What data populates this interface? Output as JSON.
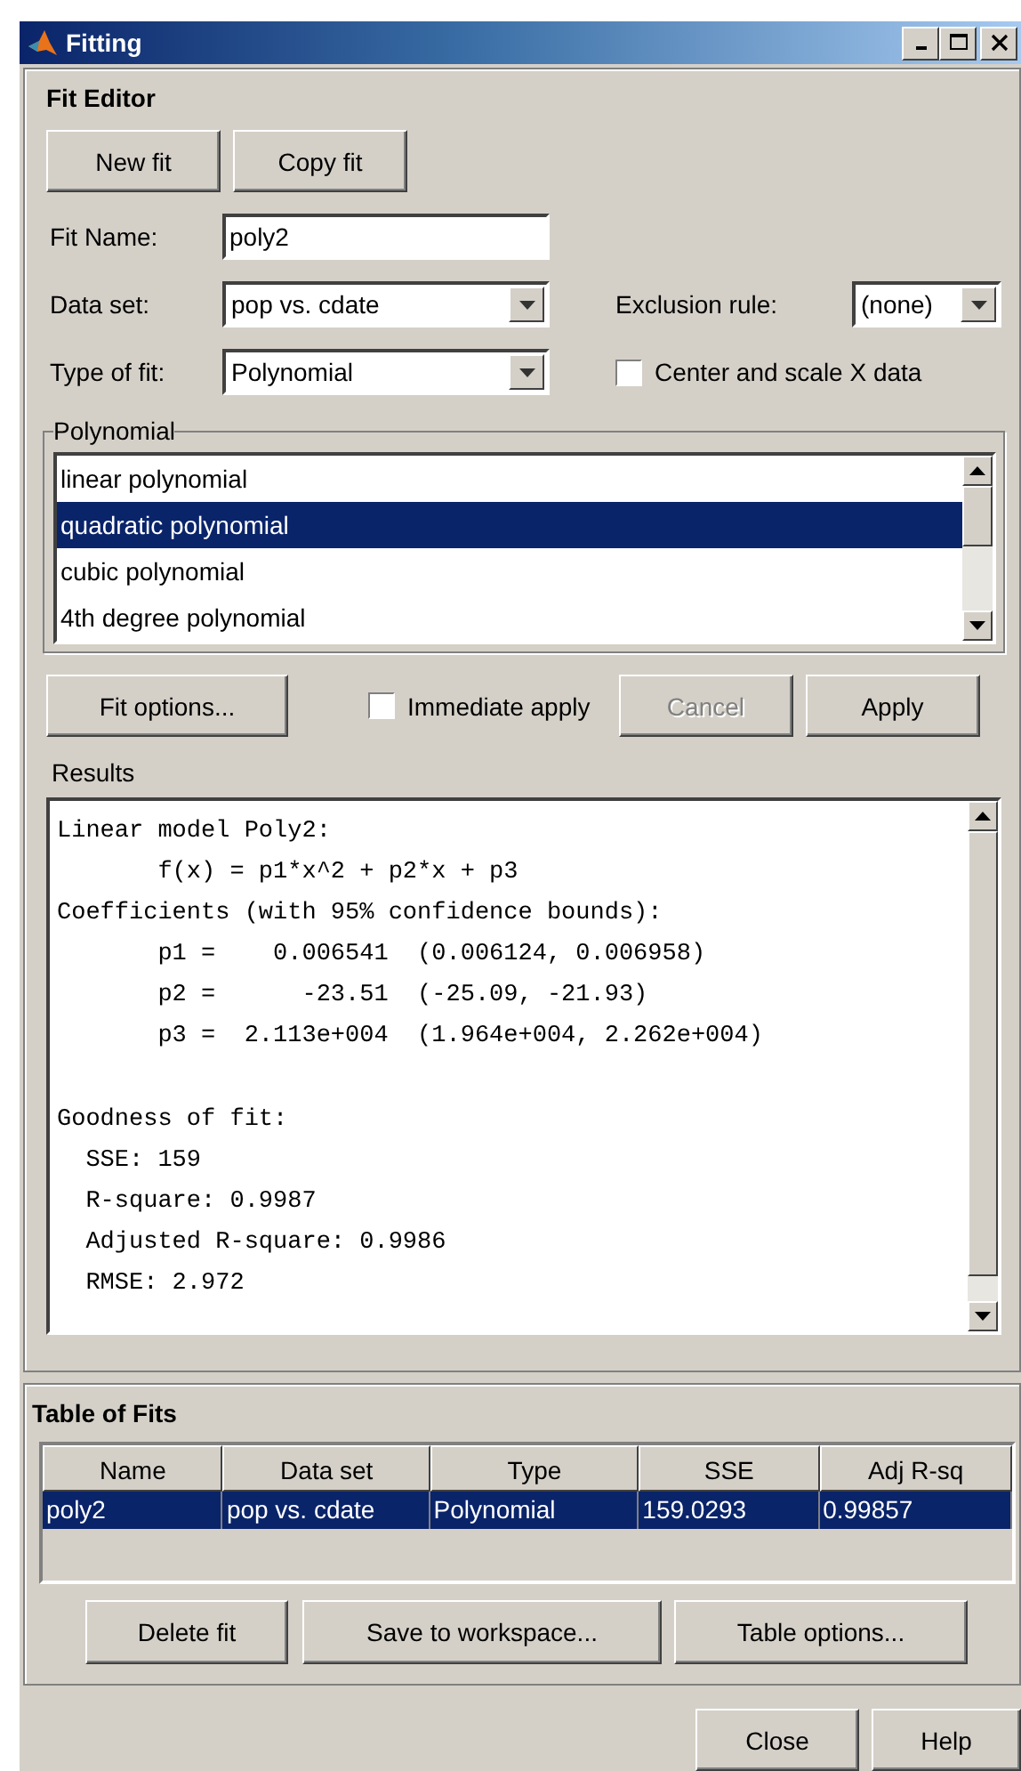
{
  "window": {
    "title": "Fitting"
  },
  "fit_editor": {
    "title": "Fit Editor",
    "buttons": [
      {
        "label": "New fit"
      },
      {
        "label": "Copy fit"
      }
    ],
    "fit_name": {
      "label": "Fit Name:",
      "value": "poly2"
    },
    "data_set": {
      "label": "Data set:",
      "value": "pop vs. cdate"
    },
    "exclusion_rule": {
      "label": "Exclusion rule:",
      "value": "(none)"
    },
    "type_of_fit": {
      "label": "Type of fit:",
      "value": "Polynomial"
    },
    "center_scale": {
      "label": "Center and scale X data",
      "checked": false
    },
    "polynomial_group": {
      "title": "Polynomial",
      "items": [
        {
          "label": "linear polynomial",
          "selected": false
        },
        {
          "label": "quadratic polynomial",
          "selected": true
        },
        {
          "label": "cubic polynomial",
          "selected": false
        },
        {
          "label": "4th degree polynomial",
          "selected": false
        }
      ]
    },
    "fit_options": {
      "label": "Fit options..."
    },
    "immediate_apply": {
      "label": "Immediate apply",
      "checked": false
    },
    "actions": [
      {
        "label": "Cancel",
        "disabled": true
      },
      {
        "label": "Apply",
        "disabled": false
      }
    ],
    "results_label": "Results",
    "results_text": "Linear model Poly2:\n       f(x) = p1*x^2 + p2*x + p3\nCoefficients (with 95% confidence bounds):\n       p1 =    0.006541  (0.006124, 0.006958)\n       p2 =      -23.51  (-25.09, -21.93)\n       p3 =  2.113e+004  (1.964e+004, 2.262e+004)\n\nGoodness of fit:\n  SSE: 159\n  R-square: 0.9987\n  Adjusted R-square: 0.9986\n  RMSE: 2.972"
  },
  "table_of_fits": {
    "title": "Table of Fits",
    "columns": [
      "Name",
      "Data set",
      "Type",
      "SSE",
      "Adj R-sq"
    ],
    "rows": [
      {
        "cells": [
          "poly2",
          "pop vs. cdate",
          "Polynomial",
          "159.0293",
          "0.99857"
        ],
        "selected": true
      }
    ],
    "buttons": [
      {
        "label": "Delete fit"
      },
      {
        "label": "Save to workspace..."
      },
      {
        "label": "Table options..."
      }
    ]
  },
  "footer_buttons": [
    {
      "label": "Close"
    },
    {
      "label": "Help"
    }
  ]
}
